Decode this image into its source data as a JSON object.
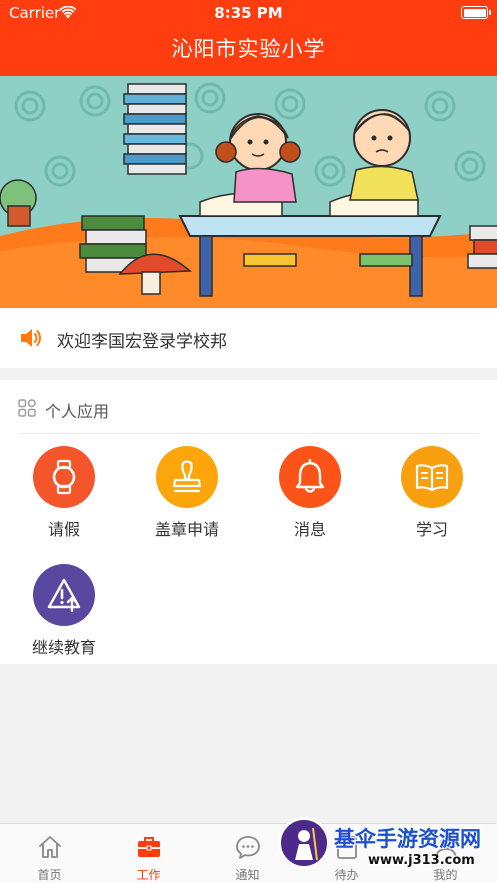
{
  "status_bar": {
    "carrier": "Carrier",
    "time": "8:35 PM"
  },
  "header": {
    "title": "沁阳市实验小学"
  },
  "banner": {
    "image": "cartoon-kids-reading-illustration"
  },
  "notice": {
    "icon": "speaker-icon",
    "text": "欢迎李国宏登录学校邦"
  },
  "apps": {
    "section_icon": "grid-icon",
    "section_title": "个人应用",
    "items": [
      {
        "label": "请假",
        "icon": "watch-icon",
        "color": "#f5552b"
      },
      {
        "label": "盖章申请",
        "icon": "stamp-icon",
        "color": "#fda60c"
      },
      {
        "label": "消息",
        "icon": "bell-icon",
        "color": "#fc5418"
      },
      {
        "label": "学习",
        "icon": "book-icon",
        "color": "#f8a00f"
      },
      {
        "label": "继续教育",
        "icon": "warning-upload-icon",
        "color": "#5a48a0"
      }
    ]
  },
  "tabbar": {
    "active_color": "#ff3d0e",
    "tabs": [
      {
        "label": "首页",
        "icon": "home-icon"
      },
      {
        "label": "工作",
        "icon": "briefcase-icon"
      },
      {
        "label": "通知",
        "icon": "chat-icon"
      },
      {
        "label": "待办",
        "icon": "todo-icon"
      },
      {
        "label": "我的",
        "icon": "user-icon"
      }
    ]
  },
  "watermark": {
    "text": "基伞手游资源网",
    "url": "www.j313.com"
  }
}
